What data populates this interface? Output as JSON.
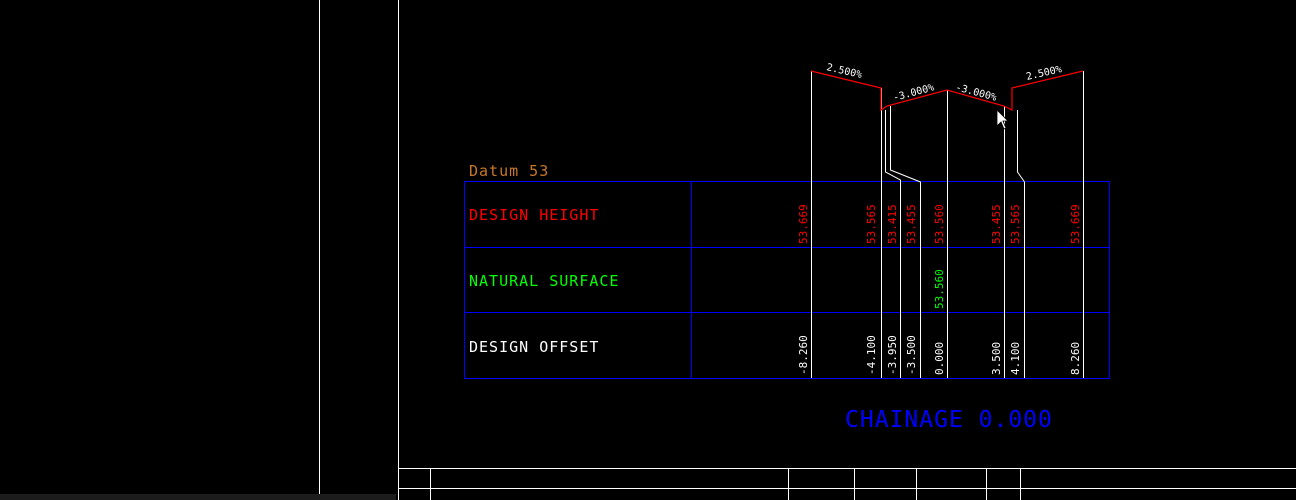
{
  "datum_label": "Datum 53",
  "rows": {
    "design_height": "DESIGN HEIGHT",
    "natural_surface": "NATURAL SURFACE",
    "design_offset": "DESIGN OFFSET"
  },
  "chainage_label": "CHAINAGE 0.000",
  "slopes": [
    "2.500%",
    "-3.000%",
    "-3.000%",
    "2.500%"
  ],
  "design_heights": [
    "53.669",
    "53.565",
    "53.415",
    "53.455",
    "53.560",
    "53.455",
    "53.565",
    "53.669"
  ],
  "natural_surface_values": [
    "53.560"
  ],
  "design_offsets": [
    "-8.260",
    "-4.100",
    "-3.950",
    "-3.500",
    "0.000",
    "3.500",
    "4.100",
    "8.260"
  ],
  "colors": {
    "background": "#000000",
    "grid": "#0000ff",
    "design": "#ff0000",
    "natural": "#00ff00",
    "text": "#ffffff",
    "datum": "#c87828",
    "chainage": "#0000ff"
  }
}
